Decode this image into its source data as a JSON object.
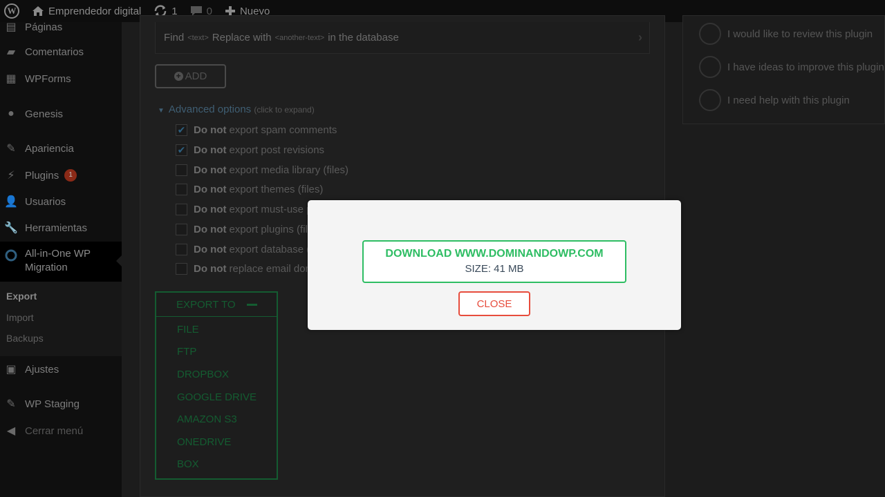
{
  "admin_bar": {
    "site_name": "Emprendedor digital",
    "updates_count": "1",
    "comments_count": "0",
    "new_label": "Nuevo"
  },
  "sidebar": {
    "items": [
      {
        "label": "Páginas",
        "icon": "pages-icon"
      },
      {
        "label": "Comentarios",
        "icon": "comments-icon"
      },
      {
        "label": "WPForms",
        "icon": "wpforms-icon"
      },
      {
        "label": "Genesis",
        "icon": "genesis-icon"
      },
      {
        "label": "Apariencia",
        "icon": "appearance-icon"
      },
      {
        "label": "Plugins",
        "icon": "plugins-icon",
        "badge": "1"
      },
      {
        "label": "Usuarios",
        "icon": "users-icon"
      },
      {
        "label": "Herramientas",
        "icon": "tools-icon"
      },
      {
        "label": "All-in-One WP",
        "label2": "Migration",
        "icon": "migration-icon"
      },
      {
        "label": "Ajustes",
        "icon": "settings-icon"
      },
      {
        "label": "WP Staging",
        "icon": "staging-icon"
      },
      {
        "label": "Cerrar menú",
        "icon": "collapse-icon"
      }
    ],
    "submenu": [
      "Export",
      "Import",
      "Backups"
    ]
  },
  "main": {
    "find_row": {
      "find": "Find",
      "text_tag": "<text>",
      "replace": "Replace with",
      "another_tag": "<another-text>",
      "suffix": "in the database"
    },
    "add_label": "ADD",
    "advanced": {
      "label": "Advanced options",
      "hint": "(click to expand)"
    },
    "options": [
      {
        "bold": "Do not",
        "rest": "export spam comments",
        "checked": true
      },
      {
        "bold": "Do not",
        "rest": "export post revisions",
        "checked": true
      },
      {
        "bold": "Do not",
        "rest": "export media library (files)",
        "checked": false
      },
      {
        "bold": "Do not",
        "rest": "export themes (files)",
        "checked": false
      },
      {
        "bold": "Do not",
        "rest": "export must-use p",
        "checked": false
      },
      {
        "bold": "Do not",
        "rest": "export plugins (file",
        "checked": false
      },
      {
        "bold": "Do not",
        "rest": "export database (s",
        "checked": false
      },
      {
        "bold": "Do not",
        "rest": "replace email dom",
        "checked": false
      }
    ],
    "export_to": {
      "label": "EXPORT TO",
      "options": [
        "FILE",
        "FTP",
        "DROPBOX",
        "GOOGLE DRIVE",
        "AMAZON S3",
        "ONEDRIVE",
        "BOX"
      ]
    }
  },
  "right_panel": {
    "options": [
      "I would like to review this plugin",
      "I have ideas to improve this plugin",
      "I need help with this plugin"
    ]
  },
  "modal": {
    "download_label": "DOWNLOAD WWW.DOMINANDOWP.COM",
    "size_label": "SIZE: 41 MB",
    "close_label": "CLOSE"
  }
}
